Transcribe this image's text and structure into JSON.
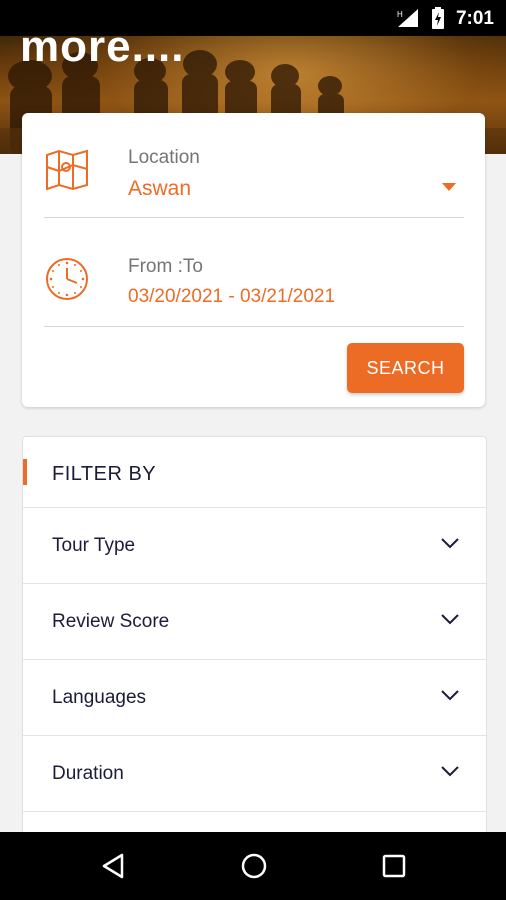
{
  "status_bar": {
    "time": "7:01"
  },
  "hero": {
    "title_fragment": "more...."
  },
  "search": {
    "location": {
      "label": "Location",
      "value": "Aswan"
    },
    "dates": {
      "label": "From :To",
      "value": "03/20/2021 - 03/21/2021"
    },
    "search_button": "SEARCH"
  },
  "filters": {
    "title": "FILTER BY",
    "items": [
      {
        "label": "Tour Type"
      },
      {
        "label": "Review Score"
      },
      {
        "label": "Languages"
      },
      {
        "label": "Duration"
      }
    ]
  },
  "colors": {
    "accent": "#ec6c25",
    "text_dark": "#1c1c3a",
    "label_gray": "#757575"
  },
  "icons": {
    "location": "map-icon",
    "dates": "clock-icon",
    "dropdown": "dropdown-caret-icon",
    "filter_row": "chevron-down-icon",
    "nav": [
      "back-triangle-icon",
      "home-circle-icon",
      "recents-square-icon"
    ]
  }
}
